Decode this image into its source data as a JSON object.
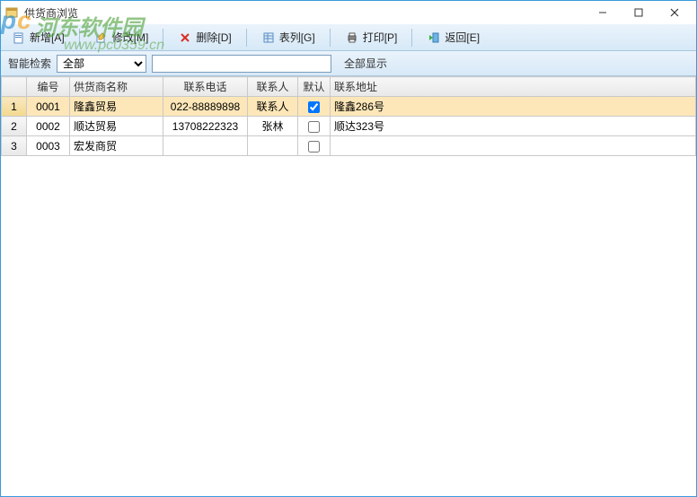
{
  "titlebar": {
    "title": "供货商浏览"
  },
  "toolbar": {
    "new_label": "新增[A]",
    "edit_label": "修改[M]",
    "delete_label": "删除[D]",
    "grid_label": "表列[G]",
    "print_label": "打印[P]",
    "back_label": "返回[E]"
  },
  "filter": {
    "search_label": "智能检索",
    "select_value": "全部",
    "select_options": [
      "全部"
    ],
    "input_value": "",
    "show_all_label": "全部显示"
  },
  "table": {
    "headers": {
      "row_num": "",
      "code": "编号",
      "name": "供货商名称",
      "phone": "联系电话",
      "contact": "联系人",
      "default": "默认",
      "address": "联系地址"
    },
    "rows": [
      {
        "idx": "1",
        "code": "0001",
        "name": "隆鑫贸易",
        "phone": "022-88889898",
        "contact": "联系人",
        "default": true,
        "address": "隆鑫286号",
        "selected": true
      },
      {
        "idx": "2",
        "code": "0002",
        "name": "顺达贸易",
        "phone": "13708222323",
        "contact": "张林",
        "default": false,
        "address": "顺达323号",
        "selected": false
      },
      {
        "idx": "3",
        "code": "0003",
        "name": "宏发商贸",
        "phone": "",
        "contact": "",
        "default": false,
        "address": "",
        "selected": false
      }
    ]
  },
  "watermark": {
    "brand": "河东软件园",
    "url": "www.pc0359.cn"
  }
}
